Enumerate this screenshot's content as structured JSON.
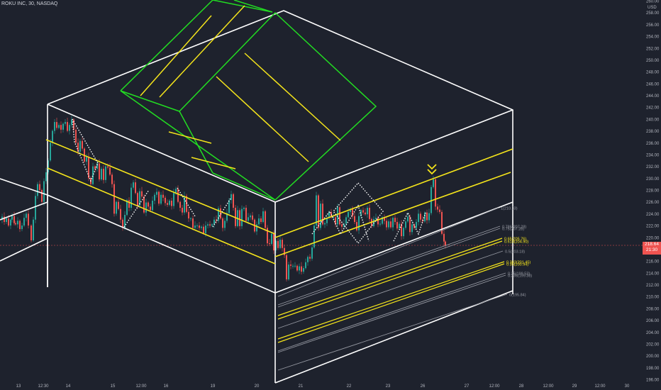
{
  "header": {
    "symbol": "ROKU INC, 30, NASDAQ"
  },
  "current_price": {
    "value": "218.64",
    "countdown": "21:30"
  },
  "colors": {
    "background": "#1e222d",
    "up": "#26a69a",
    "down": "#ef5350",
    "box": "#ffffff",
    "channel": "#f5e51b",
    "flag": "#22dd22",
    "fib_gray": "#9598a1",
    "fib_yellow": "#f5e51b"
  },
  "chart_data": {
    "type": "candlestick",
    "title": "",
    "price_axis": {
      "currency": "USD",
      "ylim": [
        194,
        262
      ],
      "ticks": [
        "260.00",
        "258.00",
        "256.00",
        "254.00",
        "252.00",
        "250.00",
        "248.00",
        "246.00",
        "244.00",
        "242.00",
        "240.00",
        "238.00",
        "236.00",
        "234.00",
        "232.00",
        "230.00",
        "228.00",
        "226.00",
        "224.00",
        "222.00",
        "220.00",
        "218.00",
        "216.00",
        "214.00",
        "212.00",
        "210.00",
        "208.00",
        "206.00",
        "204.00",
        "202.00",
        "200.00",
        "198.00",
        "196.00"
      ]
    },
    "time_axis": {
      "ticks": [
        "13",
        "12:30",
        "14",
        "15",
        "12:00",
        "16",
        "19",
        "20",
        "21",
        "22",
        "23",
        "26",
        "27",
        "12:00",
        "28",
        "12:00",
        "29",
        "12:00",
        "30"
      ]
    },
    "price_path": [
      [
        0,
        223.0
      ],
      [
        3,
        223.5
      ],
      [
        6,
        222.6
      ],
      [
        9,
        223.2
      ],
      [
        12,
        222.0
      ],
      [
        15,
        223.0
      ],
      [
        17,
        223.6
      ],
      [
        20,
        222.4
      ],
      [
        22,
        222.2
      ],
      [
        25,
        222.8
      ],
      [
        28,
        221.4
      ],
      [
        31,
        222.0
      ],
      [
        34,
        223.3
      ],
      [
        37,
        224.0
      ],
      [
        40,
        222.0
      ],
      [
        44,
        219.5
      ],
      [
        47,
        223.0
      ],
      [
        50,
        227.0
      ],
      [
        53,
        229.0
      ],
      [
        56,
        228.0
      ],
      [
        59,
        226.0
      ],
      [
        62,
        229.5
      ],
      [
        65,
        231.0
      ],
      [
        68,
        233.0
      ],
      [
        71,
        236.0
      ],
      [
        74,
        238.0
      ],
      [
        77,
        239.5
      ],
      [
        80,
        238.5
      ],
      [
        83,
        239.0
      ],
      [
        86,
        238.2
      ],
      [
        89,
        239.2
      ],
      [
        92,
        239.5
      ],
      [
        95,
        238.0
      ],
      [
        98,
        239.0
      ],
      [
        101,
        239.9
      ],
      [
        104,
        238.2
      ],
      [
        107,
        236.0
      ],
      [
        110,
        234.5
      ],
      [
        113,
        236.3
      ],
      [
        116,
        235.0
      ],
      [
        119,
        232.8
      ],
      [
        122,
        233.6
      ],
      [
        125,
        230.0
      ],
      [
        128,
        229.0
      ],
      [
        131,
        232.0
      ],
      [
        134,
        231.6
      ],
      [
        137,
        232.5
      ],
      [
        140,
        229.8
      ],
      [
        143,
        231.6
      ],
      [
        146,
        229.7
      ],
      [
        149,
        232.0
      ],
      [
        152,
        231.8
      ],
      [
        155,
        230.6
      ],
      [
        158,
        229.0
      ],
      [
        161,
        224.0
      ],
      [
        164,
        226.0
      ],
      [
        167,
        224.8
      ],
      [
        170,
        223.0
      ],
      [
        173,
        221.6
      ],
      [
        176,
        223.8
      ],
      [
        179,
        226.3
      ],
      [
        182,
        225.0
      ],
      [
        185,
        228.4
      ],
      [
        188,
        229.3
      ],
      [
        191,
        227.5
      ],
      [
        194,
        225.4
      ],
      [
        197,
        227.8
      ],
      [
        200,
        226.9
      ],
      [
        203,
        224.2
      ],
      [
        206,
        225.9
      ],
      [
        209,
        225.2
      ],
      [
        212,
        224.6
      ],
      [
        215,
        226.2
      ],
      [
        218,
        227.2
      ],
      [
        221,
        227.7
      ],
      [
        224,
        225.7
      ],
      [
        227,
        227.2
      ],
      [
        230,
        226.7
      ],
      [
        233,
        225.8
      ],
      [
        236,
        225.5
      ],
      [
        239,
        226.2
      ],
      [
        242,
        225.3
      ],
      [
        245,
        227.5
      ],
      [
        248,
        228.2
      ],
      [
        251,
        226.0
      ],
      [
        254,
        225.0
      ],
      [
        257,
        224.2
      ],
      [
        260,
        227.0
      ],
      [
        263,
        224.3
      ],
      [
        266,
        223.2
      ],
      [
        269,
        223.2
      ],
      [
        272,
        221.6
      ],
      [
        275,
        222.0
      ],
      [
        278,
        222.0
      ],
      [
        281,
        221.6
      ],
      [
        284,
        221.8
      ],
      [
        287,
        220.7
      ],
      [
        290,
        222.0
      ],
      [
        293,
        222.2
      ],
      [
        296,
        222.0
      ],
      [
        299,
        222.2
      ],
      [
        302,
        223.0
      ],
      [
        305,
        222.8
      ],
      [
        308,
        224.9
      ],
      [
        311,
        223.2
      ],
      [
        314,
        221.6
      ],
      [
        317,
        222.8
      ],
      [
        320,
        224.1
      ],
      [
        323,
        226.3
      ],
      [
        326,
        227.3
      ],
      [
        329,
        225.0
      ],
      [
        332,
        221.9
      ],
      [
        335,
        224.6
      ],
      [
        338,
        221.9
      ],
      [
        341,
        224.8
      ],
      [
        344,
        225.0
      ],
      [
        347,
        222.8
      ],
      [
        350,
        223.4
      ],
      [
        353,
        223.7
      ],
      [
        356,
        223.0
      ],
      [
        359,
        221.0
      ],
      [
        362,
        222.2
      ],
      [
        365,
        223.2
      ],
      [
        368,
        222.6
      ],
      [
        371,
        224.4
      ],
      [
        374,
        221.6
      ],
      [
        377,
        219.0
      ],
      [
        380,
        218.9
      ],
      [
        383,
        220.6
      ],
      [
        386,
        217.8
      ],
      [
        389,
        219.4
      ],
      [
        392,
        218.2
      ],
      [
        395,
        219.6
      ],
      [
        398,
        218.2
      ],
      [
        401,
        217.0
      ],
      [
        404,
        212.9
      ],
      [
        407,
        215.4
      ],
      [
        410,
        215.2
      ],
      [
        413,
        215.2
      ],
      [
        416,
        215.2
      ],
      [
        419,
        214.4
      ],
      [
        422,
        215.1
      ],
      [
        425,
        214.2
      ],
      [
        428,
        214.8
      ],
      [
        431,
        215.8
      ],
      [
        434,
        216.7
      ],
      [
        437,
        216.4
      ],
      [
        440,
        218.3
      ],
      [
        443,
        222.0
      ],
      [
        446,
        227.1
      ],
      [
        449,
        221.6
      ],
      [
        452,
        225.7
      ],
      [
        455,
        222.2
      ],
      [
        458,
        222.4
      ],
      [
        461,
        223.3
      ],
      [
        464,
        224.3
      ],
      [
        467,
        223.4
      ],
      [
        470,
        223.4
      ],
      [
        473,
        222.2
      ],
      [
        476,
        225.1
      ],
      [
        479,
        222.2
      ],
      [
        482,
        221.8
      ],
      [
        485,
        222.3
      ],
      [
        488,
        223.4
      ],
      [
        491,
        224.3
      ],
      [
        494,
        224.8
      ],
      [
        497,
        223.6
      ],
      [
        500,
        222.6
      ],
      [
        503,
        221.2
      ],
      [
        506,
        223.6
      ],
      [
        509,
        224.6
      ],
      [
        512,
        224.2
      ],
      [
        515,
        223.9
      ],
      [
        518,
        225.0
      ],
      [
        521,
        223.1
      ],
      [
        524,
        221.9
      ],
      [
        527,
        223.1
      ],
      [
        530,
        223.3
      ],
      [
        533,
        222.2
      ],
      [
        536,
        222.3
      ],
      [
        539,
        223.4
      ],
      [
        542,
        222.8
      ],
      [
        545,
        221.7
      ],
      [
        548,
        222.7
      ],
      [
        551,
        221.7
      ],
      [
        554,
        223.3
      ],
      [
        557,
        222.6
      ],
      [
        560,
        221.5
      ],
      [
        563,
        222.3
      ],
      [
        566,
        220.2
      ],
      [
        569,
        221.6
      ],
      [
        572,
        222.7
      ],
      [
        575,
        223.5
      ],
      [
        578,
        220.9
      ],
      [
        581,
        222.2
      ],
      [
        584,
        221.6
      ],
      [
        587,
        222.6
      ],
      [
        590,
        224.0
      ],
      [
        593,
        223.0
      ],
      [
        596,
        222.7
      ],
      [
        599,
        224.2
      ],
      [
        602,
        222.9
      ],
      [
        605,
        224.1
      ],
      [
        608,
        228.5
      ],
      [
        611,
        229.8
      ],
      [
        614,
        225.2
      ],
      [
        617,
        224.7
      ],
      [
        620,
        224.3
      ],
      [
        623,
        220.6
      ],
      [
        626,
        219.3
      ],
      [
        628,
        218.6
      ]
    ],
    "annotations": {
      "fib_levels": [
        {
          "label": "1(210.33)",
          "color": "gray"
        },
        {
          "label": "0.786(207.28)",
          "color": "gray"
        },
        {
          "label": "0.75(207.28)",
          "color": "gray"
        },
        {
          "label": "0.65(205.76)",
          "color": "yellow"
        },
        {
          "label": "0.618(204.90)",
          "color": "yellow"
        },
        {
          "label": "0.5(203.18)",
          "color": "gray"
        },
        {
          "label": "0.382(201.45)",
          "color": "yellow"
        },
        {
          "label": "0.35(200.94)",
          "color": "yellow"
        },
        {
          "label": "0.25(199.53)",
          "color": "gray"
        },
        {
          "label": "0.236(199.38)",
          "color": "gray"
        },
        {
          "label": "0(195.84)",
          "color": "gray"
        }
      ]
    }
  }
}
